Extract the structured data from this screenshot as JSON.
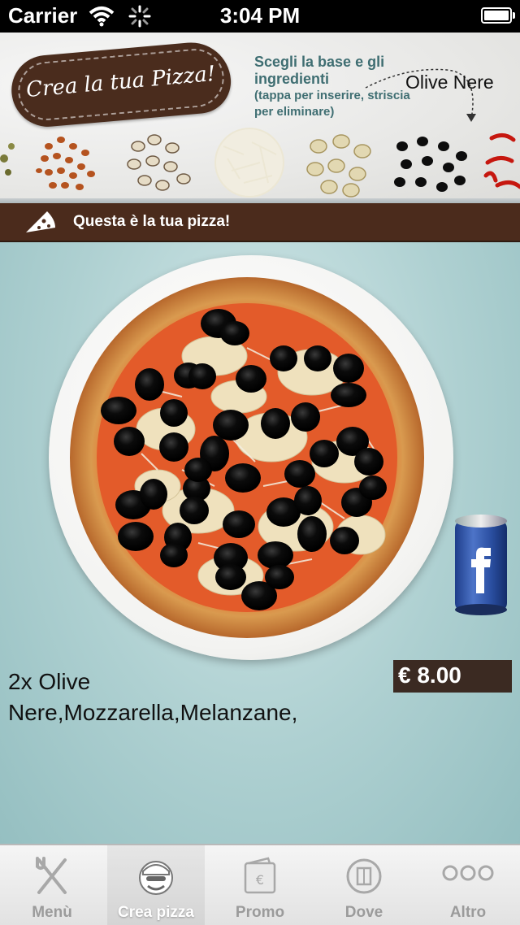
{
  "status_bar": {
    "carrier": "Carrier",
    "time": "3:04 PM",
    "battery_level": 1.0
  },
  "header": {
    "logo_text": "Crea la tua Pizza!",
    "instruction_title": "Scegli la base e gli ingredienti",
    "instruction_hint": "(tappa per inserire, striscia per eliminare)",
    "selected_ingredient": "Olive Nere",
    "ingredients_icons": [
      "herbs",
      "beans",
      "mushrooms",
      "mozzarella",
      "artichokes",
      "black-olives",
      "chili-peppers"
    ]
  },
  "section": {
    "title": "Questa è la tua pizza!"
  },
  "pizza": {
    "toppings": [
      "Olive Nere",
      "Mozzarella",
      "Melanzane"
    ],
    "order_line": "2x Olive Nere,Mozzarella,Melanzane,",
    "price": "€ 8.00"
  },
  "colors": {
    "brown": "#4b2b1c",
    "teal_text": "#3f6e72",
    "background": "#aed0d1"
  },
  "tabs": [
    {
      "label": "Menù",
      "icon": "fork-knife-icon",
      "active": false
    },
    {
      "label": "Crea pizza",
      "icon": "chef-icon",
      "active": true
    },
    {
      "label": "Promo",
      "icon": "wallet-euro-icon",
      "active": false
    },
    {
      "label": "Dove",
      "icon": "map-icon",
      "active": false
    },
    {
      "label": "Altro",
      "icon": "more-icon",
      "active": false
    }
  ]
}
